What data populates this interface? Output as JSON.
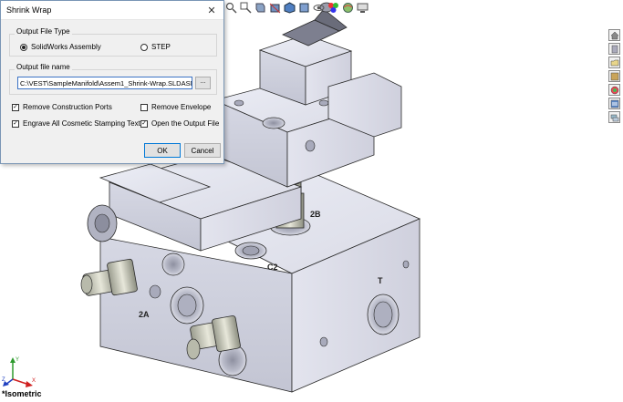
{
  "view": {
    "label": "*Isometric"
  },
  "part_labels": {
    "port_2b": "2B",
    "port_c2": "C2",
    "port_t": "T",
    "port_2a": "2A"
  },
  "dialog": {
    "title": "Shrink Wrap",
    "close_symbol": "✕",
    "output_type_group": "Output File Type",
    "option_assembly": "SolidWorks Assembly",
    "option_step": "STEP",
    "selected_type": "SolidWorks Assembly",
    "file_name_group": "Output file name",
    "file_name_value": "C:\\VEST\\SampleManifold\\Assem1_Shrink-Wrap.SLDASM",
    "browse_label": "...",
    "check_remove_construction": "Remove Construction Ports",
    "check_remove_construction_checked": true,
    "check_remove_envelope": "Remove Envelope",
    "check_remove_envelope_checked": false,
    "check_engrave": "Engrave All Cosmetic Stamping Text",
    "check_engrave_checked": true,
    "check_open_output": "Open the Output File",
    "check_open_output_checked": true,
    "ok_label": "OK",
    "cancel_label": "Cancel"
  },
  "toolbar": {
    "icons": [
      "zoom-fit-icon",
      "zoom-area-icon",
      "previous-view-icon",
      "section-view-icon",
      "view-orientation-icon",
      "display-style-icon",
      "hide-show-icon",
      "edit-appearance-icon",
      "apply-scene-icon",
      "view-settings-icon"
    ]
  },
  "taskpane": {
    "icons": [
      "home-icon",
      "design-library-icon",
      "file-explorer-icon",
      "view-palette-icon",
      "appearances-icon",
      "custom-properties-icon",
      "forum-icon"
    ]
  },
  "triad": {
    "x": "X",
    "y": "Y",
    "z": "Z"
  }
}
